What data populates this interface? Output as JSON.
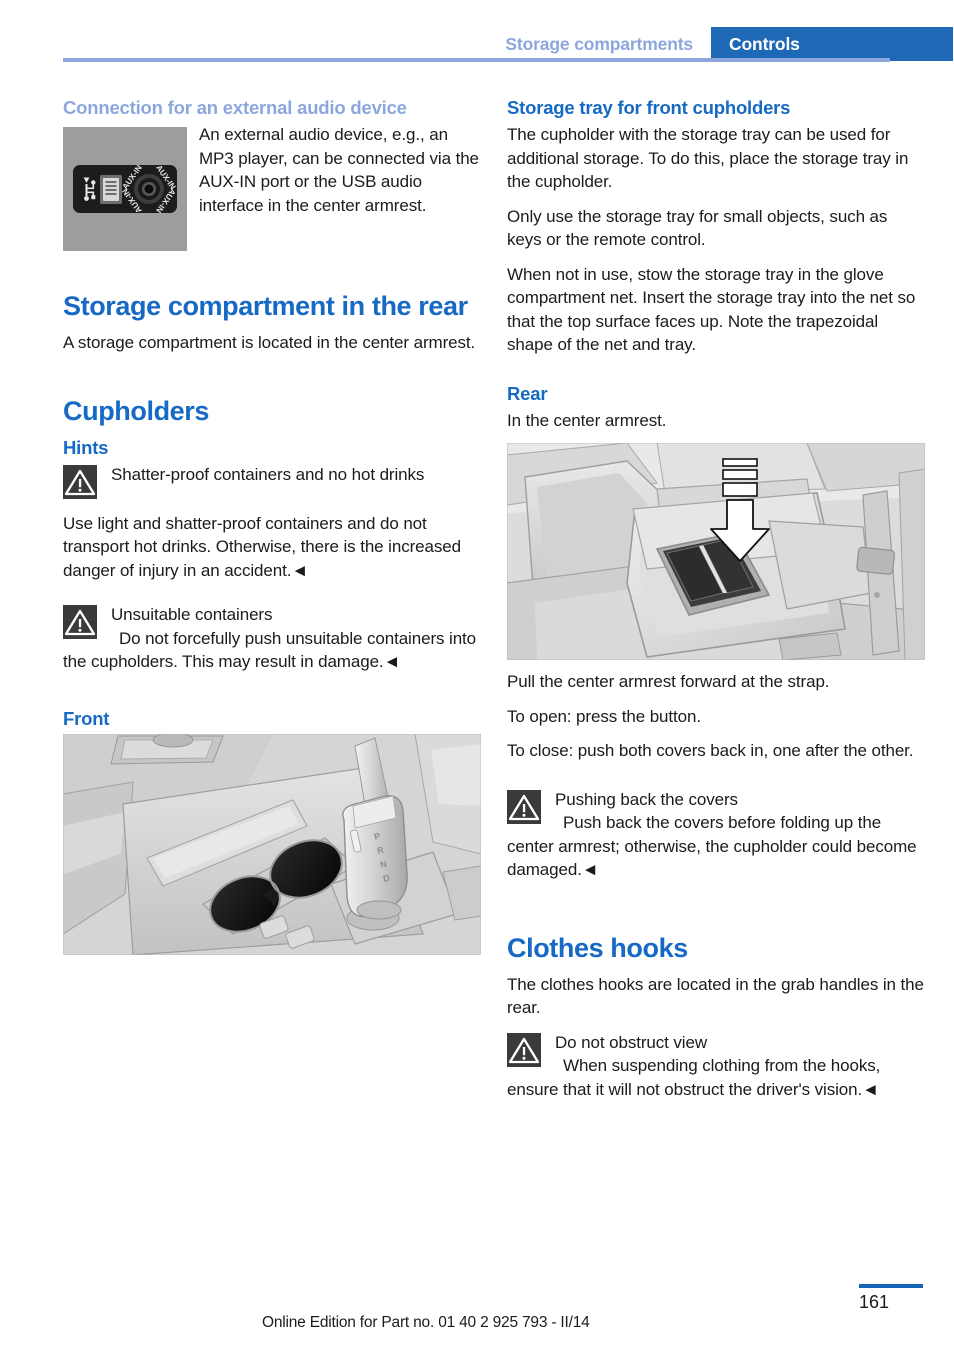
{
  "header": {
    "section": "Storage compartments",
    "chapter": "Controls"
  },
  "left_column": {
    "audio_heading": "Connection for an external audio device",
    "audio_figure_alt": "usb-aux-in-port-panel",
    "audio_text": "An external audio device, e.g., an MP3 player, can be connected via the AUX-IN port or the USB audio interface in the center armrest.",
    "rear_storage_heading": "Storage compartment in the rear",
    "rear_storage_text": "A storage compartment is located in the center armrest.",
    "cupholders_heading": "Cupholders",
    "hints_heading": "Hints",
    "warning1_head": "Shatter-proof containers and no hot drinks",
    "warning1_body": "Use light and shatter-proof containers and do not transport hot drinks. Otherwise, there is the increased danger of injury in an accident.◄",
    "warning2_head": "Unsuitable containers",
    "warning2_body": "Do not forcefully push unsuitable containers into the cupholders. This may result in damage.◄",
    "front_heading": "Front",
    "front_figure_alt": "front-center-console-cupholders-illustration"
  },
  "right_column": {
    "tray_heading": "Storage tray for front cupholders",
    "tray_p1": "The cupholder with the storage tray can be used for additional storage. To do this, place the storage tray in the cupholder.",
    "tray_p2": "Only use the storage tray for small objects, such as keys or the remote control.",
    "tray_p3": "When not in use, stow the storage tray in the glove compartment net. Insert the storage tray into the net so that the top surface faces up. Note the trapezoidal shape of the net and tray.",
    "rear_heading": "Rear",
    "rear_text": "In the center armrest.",
    "rear_figure_alt": "rear-center-armrest-illustration",
    "rear_p1": "Pull the center armrest forward at the strap.",
    "rear_p2": "To open: press the button.",
    "rear_p3": "To close: push both covers back in, one after the other.",
    "warning3_head": "Pushing back the covers",
    "warning3_body": "Push back the covers before folding up the center armrest; otherwise, the cupholder could become damaged.◄",
    "hooks_heading": "Clothes hooks",
    "hooks_text": "The clothes hooks are located in the grab handles in the rear.",
    "warning4_head": "Do not obstruct view",
    "warning4_body": "When suspending clothing from the hooks, ensure that it will not obstruct the driver's vision.◄"
  },
  "footer": {
    "note": "Online Edition for Part no. 01 40 2 925 793 - II/14",
    "page_number": "161"
  },
  "colors": {
    "heading_blue": "#1669c4",
    "muted_blue": "#8da6dd",
    "chapter_bar": "#1f68b5",
    "warning_icon_bg": "#3a3a3a",
    "page_rule": "#1566b8"
  }
}
